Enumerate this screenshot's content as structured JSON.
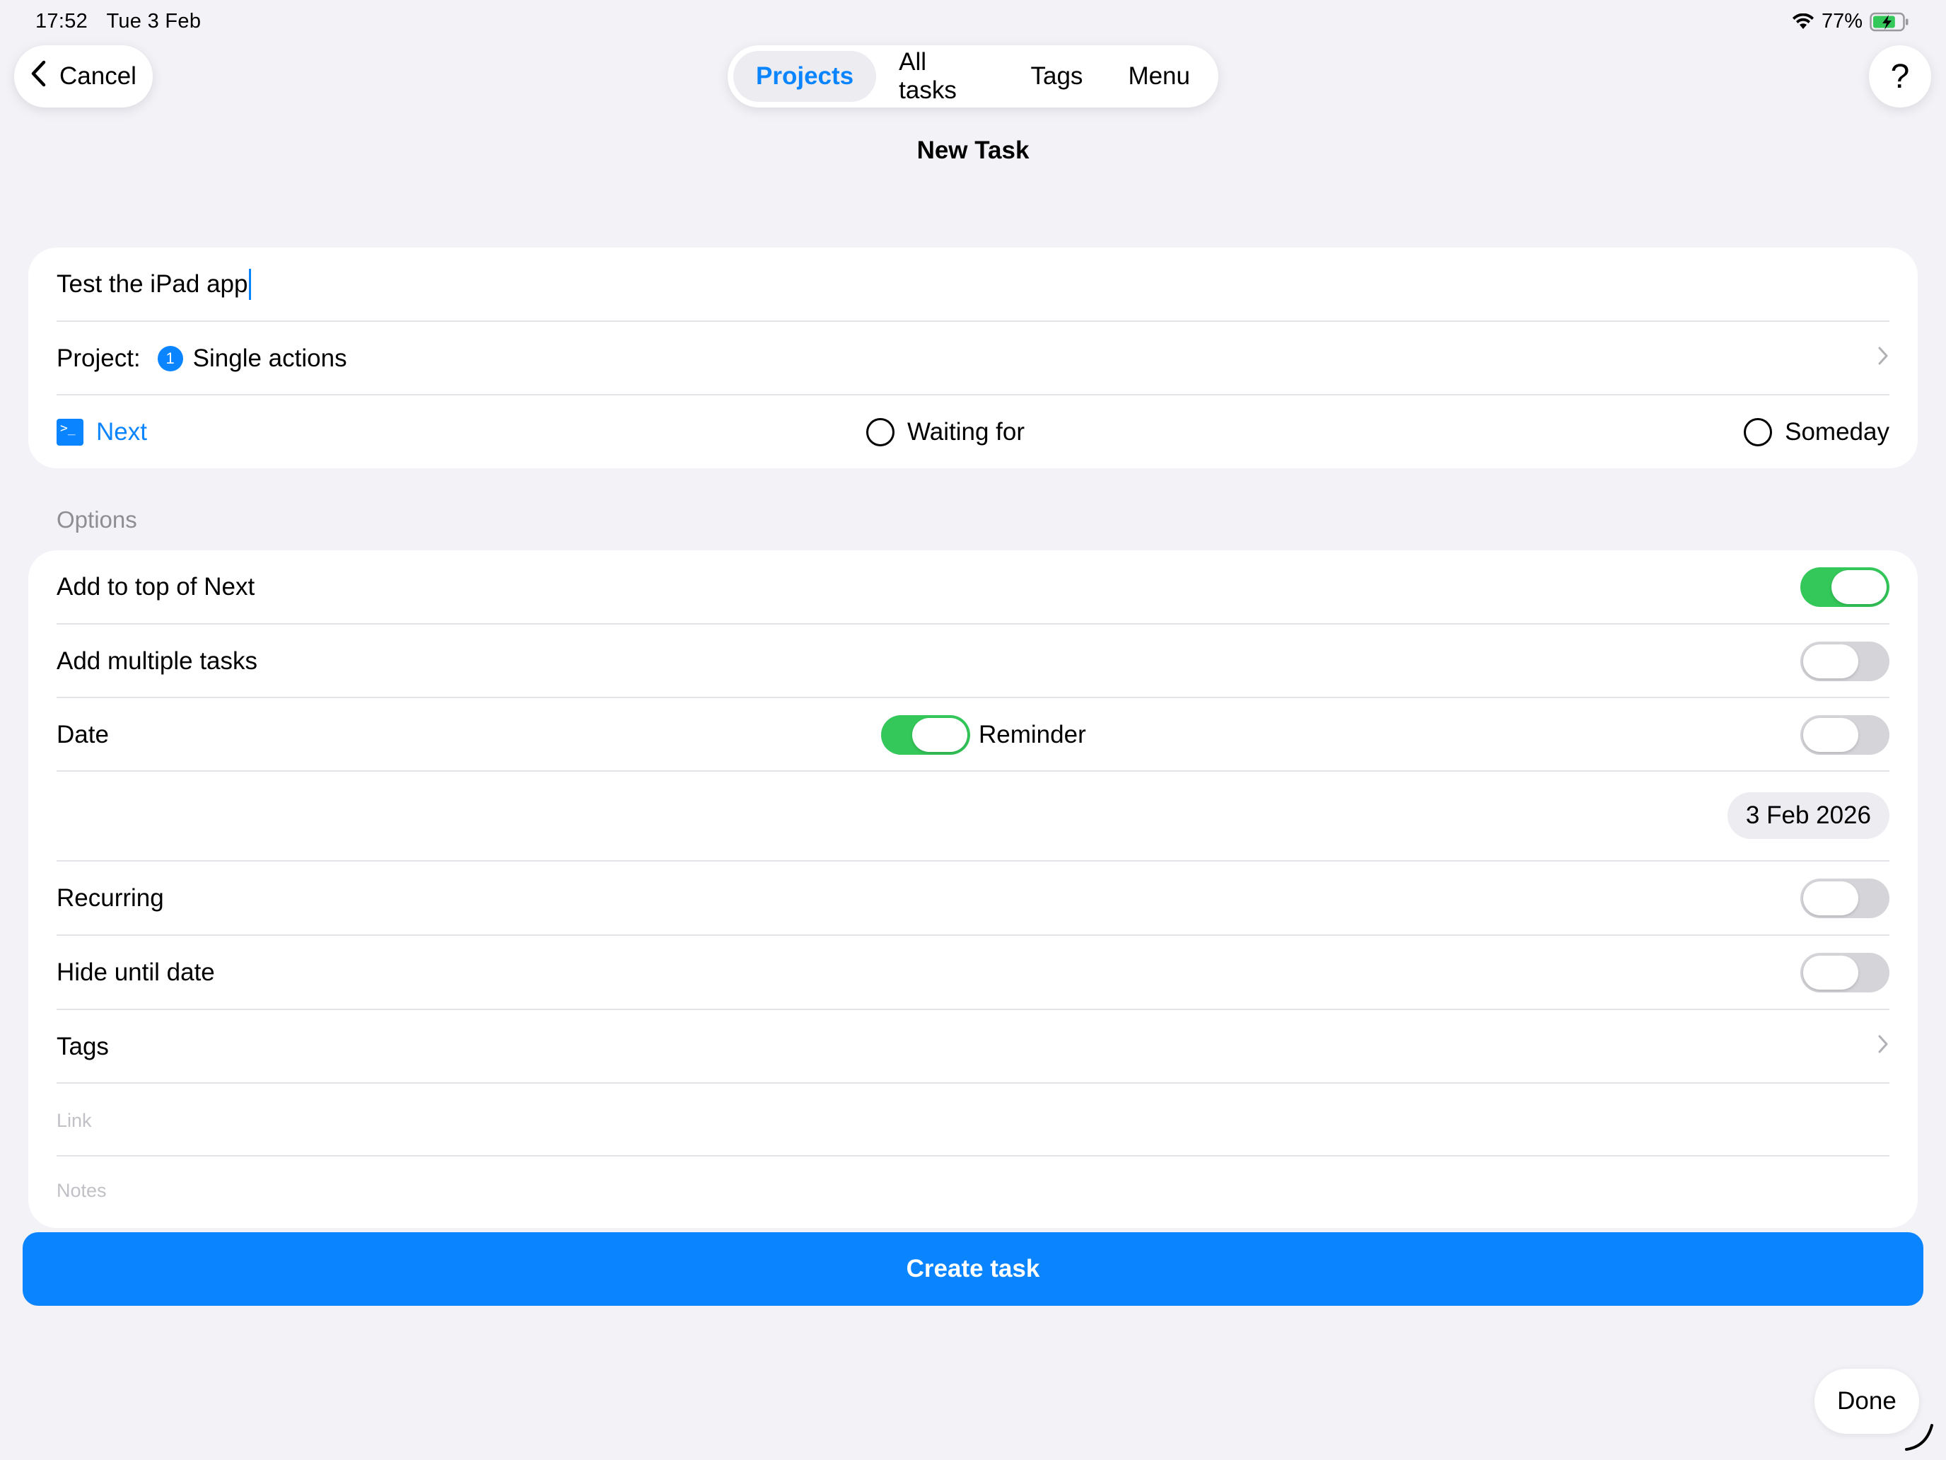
{
  "status_bar": {
    "time": "17:52",
    "date": "Tue 3 Feb",
    "battery_percent": "77%",
    "battery_level": 0.77,
    "battery_charging": true,
    "icons": [
      "wifi-icon",
      "battery-charging-icon"
    ]
  },
  "top_bar": {
    "cancel_label": "Cancel",
    "help_label": "?",
    "tabs": [
      {
        "label": "Projects",
        "active": true
      },
      {
        "label": "All tasks",
        "active": false
      },
      {
        "label": "Tags",
        "active": false
      },
      {
        "label": "Menu",
        "active": false
      }
    ]
  },
  "page_title": "New Task",
  "task": {
    "title_value": "Test the iPad app",
    "project_label": "Project:",
    "project_badge": "1",
    "project_name": "Single actions",
    "statuses": [
      {
        "label": "Next",
        "selected": true
      },
      {
        "label": "Waiting for",
        "selected": false
      },
      {
        "label": "Someday",
        "selected": false
      }
    ]
  },
  "options": {
    "section_label": "Options",
    "add_to_top_label": "Add to top of Next",
    "add_to_top_on": true,
    "add_multiple_label": "Add multiple tasks",
    "add_multiple_on": false,
    "date_label": "Date",
    "date_on": true,
    "reminder_label": "Reminder",
    "reminder_on": false,
    "date_value": "3 Feb 2026",
    "recurring_label": "Recurring",
    "recurring_on": false,
    "hide_until_label": "Hide until date",
    "hide_until_on": false,
    "tags_label": "Tags",
    "link_placeholder": "Link",
    "notes_placeholder": "Notes"
  },
  "create_button_label": "Create task",
  "done_label": "Done",
  "colors": {
    "accent": "#0a84ff",
    "toggle_on": "#34c759",
    "toggle_off": "#d5d5d9",
    "background": "#f2f2f7"
  }
}
